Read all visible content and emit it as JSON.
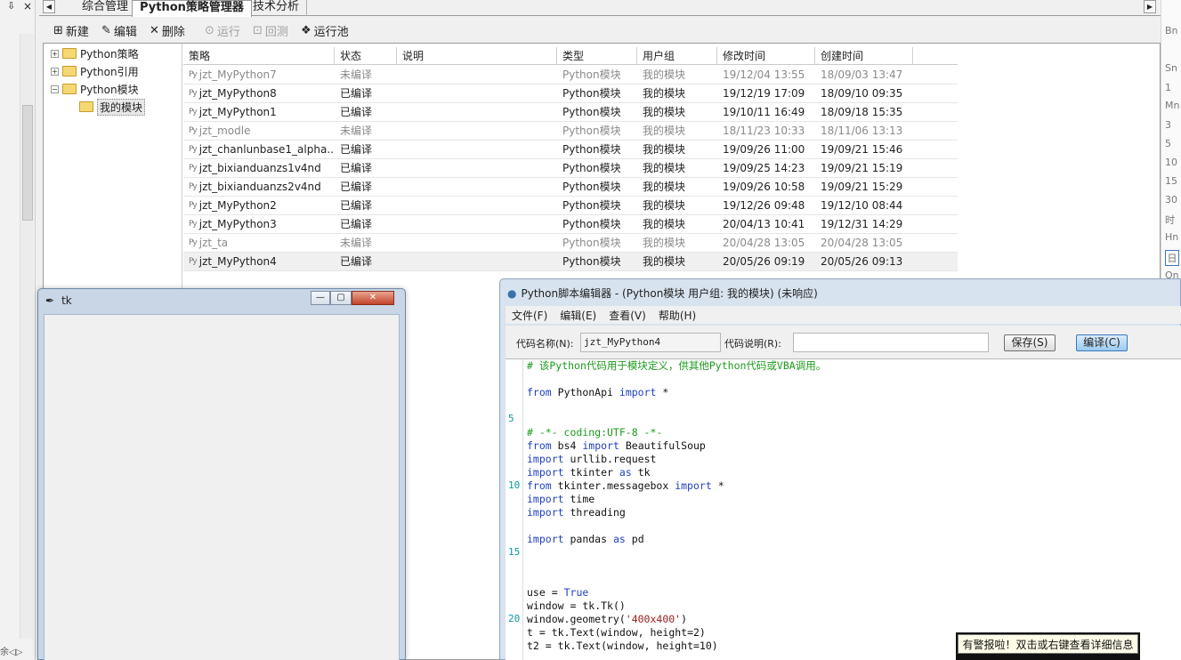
{
  "left_strip": {
    "pin": "⇩",
    "close": "×",
    "bottom": "余◁▷"
  },
  "tabs": [
    {
      "label": "综合管理"
    },
    {
      "label": "Python策略管理器"
    },
    {
      "label": "技术分析"
    }
  ],
  "right_strip": [
    "Bn",
    "Sn",
    "1",
    "Mn",
    "3",
    "5",
    "10",
    "15",
    "30",
    "时",
    "Hn",
    "日",
    "On"
  ],
  "toolbar": {
    "new": "新建",
    "edit": "编辑",
    "delete": "删除",
    "run": "运行",
    "backtest": "回测",
    "run_pool": "运行池"
  },
  "tree": {
    "items": [
      {
        "label": "Python策略"
      },
      {
        "label": "Python引用"
      },
      {
        "label": "Python模块"
      },
      {
        "label": "我的模块"
      }
    ]
  },
  "grid": {
    "headers": [
      "策略",
      "状态",
      "说明",
      "类型",
      "用户组",
      "修改时间",
      "创建时间"
    ],
    "rows": [
      {
        "name": "jzt_MyPython7",
        "status": "未编译",
        "desc": "",
        "type": "Python模块",
        "group": "我的模块",
        "modified": "19/12/04 13:55",
        "created": "18/09/03 13:47"
      },
      {
        "name": "jzt_MyPython8",
        "status": "已编译",
        "desc": "",
        "type": "Python模块",
        "group": "我的模块",
        "modified": "19/12/19 17:09",
        "created": "18/09/10 09:35"
      },
      {
        "name": "jzt_MyPython1",
        "status": "已编译",
        "desc": "",
        "type": "Python模块",
        "group": "我的模块",
        "modified": "19/10/11 16:49",
        "created": "18/09/18 15:35"
      },
      {
        "name": "jzt_modle",
        "status": "未编译",
        "desc": "",
        "type": "Python模块",
        "group": "我的模块",
        "modified": "18/11/23 10:33",
        "created": "18/11/06 13:13"
      },
      {
        "name": "jzt_chanlunbase1_alpha...",
        "status": "已编译",
        "desc": "",
        "type": "Python模块",
        "group": "我的模块",
        "modified": "19/09/26 11:00",
        "created": "19/09/21 15:46"
      },
      {
        "name": "jzt_bixianduanzs1v4nd",
        "status": "已编译",
        "desc": "",
        "type": "Python模块",
        "group": "我的模块",
        "modified": "19/09/25 14:23",
        "created": "19/09/21 15:19"
      },
      {
        "name": "jzt_bixianduanzs2v4nd",
        "status": "已编译",
        "desc": "",
        "type": "Python模块",
        "group": "我的模块",
        "modified": "19/09/26 10:58",
        "created": "19/09/21 15:29"
      },
      {
        "name": "jzt_MyPython2",
        "status": "已编译",
        "desc": "",
        "type": "Python模块",
        "group": "我的模块",
        "modified": "19/12/26 09:48",
        "created": "19/12/10 08:44"
      },
      {
        "name": "jzt_MyPython3",
        "status": "已编译",
        "desc": "",
        "type": "Python模块",
        "group": "我的模块",
        "modified": "20/04/13 10:41",
        "created": "19/12/31 14:29"
      },
      {
        "name": "jzt_ta",
        "status": "未编译",
        "desc": "",
        "type": "Python模块",
        "group": "我的模块",
        "modified": "20/04/28 13:05",
        "created": "20/04/28 13:05"
      },
      {
        "name": "jzt_MyPython4",
        "status": "已编译",
        "desc": "",
        "type": "Python模块",
        "group": "我的模块",
        "modified": "20/05/26 09:19",
        "created": "20/05/26 09:13"
      }
    ]
  },
  "tk_window": {
    "title": "tk",
    "minimize": "—",
    "maximize": "▢",
    "close": "✕"
  },
  "editor": {
    "title": "Python脚本编辑器 - (Python模块 用户组: 我的模块) (未响应)",
    "menu": [
      "文件(F)",
      "编辑(E)",
      "查看(V)",
      "帮助(H)"
    ],
    "code_name_label": "代码名称(N):",
    "code_name_value": "jzt_MyPython4",
    "code_desc_label": "代码说明(R):",
    "code_desc_value": "",
    "save_button": "保存(S)",
    "compile_button": "编译(C)",
    "line_numbers": [
      "5",
      "10",
      "15",
      "20"
    ],
    "lines": [
      "# 该Python代码用于模块定义，供其他Python代码或VBA调用。",
      "",
      "from PythonApi import *",
      "",
      "",
      "# -*- coding:UTF-8 -*-",
      "from bs4 import BeautifulSoup",
      "import urllib.request",
      "import tkinter as tk",
      "from tkinter.messagebox import *",
      "import time",
      "import threading",
      "",
      "import pandas as pd",
      "",
      "",
      "",
      "use = True",
      "window = tk.Tk()",
      "window.geometry('400x400')",
      "t = tk.Text(window, height=2)",
      "t2 = tk.Text(window, height=10)"
    ]
  },
  "tooltip": {
    "text": "有警报啦！双击或右键查看详细信息"
  }
}
